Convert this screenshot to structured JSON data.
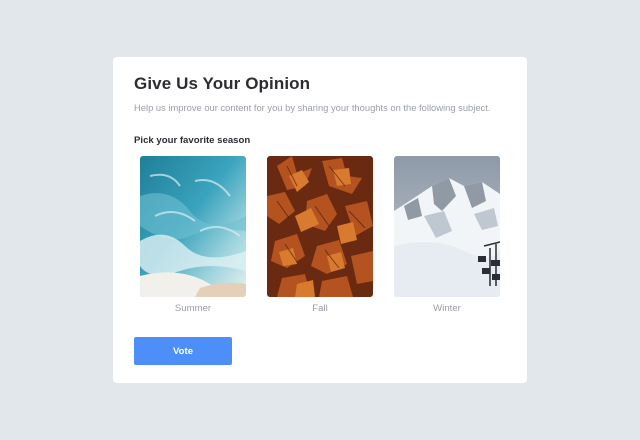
{
  "survey": {
    "title": "Give Us Your Opinion",
    "subtitle": "Help us improve our content for you by sharing your thoughts on the following subject.",
    "question": "Pick your favorite season",
    "options": [
      {
        "label": "Summer",
        "image": "ocean-waves-beach-photo"
      },
      {
        "label": "Fall",
        "image": "autumn-leaves-photo"
      },
      {
        "label": "Winter",
        "image": "snowy-mountains-ski-lift-photo"
      }
    ],
    "vote_label": "Vote"
  },
  "colors": {
    "page_background": "#e2e7ec",
    "card_background": "#ffffff",
    "button_accent": "#4d8ef8",
    "title_text": "#2b2d31",
    "muted_text": "#9a9ea6"
  }
}
